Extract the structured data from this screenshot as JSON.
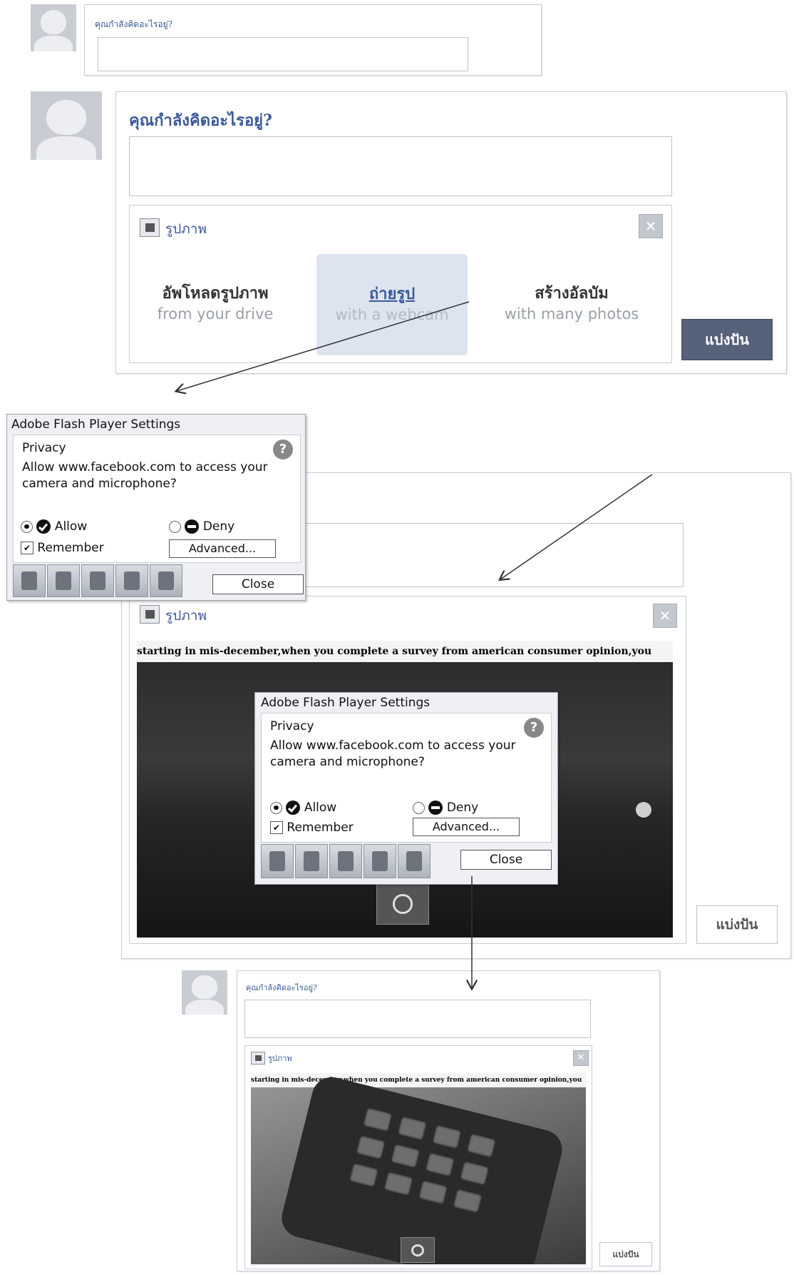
{
  "prompt": "คุณกำลังคิดอะไรอยู่?",
  "photo_panel": {
    "title": "รูปภาพ",
    "close_glyph": "✕",
    "upload": {
      "title": "อัพโหลดรูปภาพ",
      "subtitle": "from your drive"
    },
    "webcam": {
      "title": "ถ่ายรูป",
      "subtitle": "with a webcam"
    },
    "album": {
      "title": "สร้างอัลบัม",
      "subtitle": "with many photos"
    }
  },
  "share_label": "แบ่งปัน",
  "flash": {
    "title": "Adobe Flash Player Settings",
    "heading": "Privacy",
    "help": "?",
    "message": "Allow www.facebook.com to access your camera and microphone?",
    "allow": "Allow",
    "deny": "Deny",
    "remember": "Remember",
    "check": "✔",
    "advanced": "Advanced...",
    "close": "Close"
  },
  "ticker": "starting in mis-december,when you complete a survey from american consumer opinion,you",
  "colors": {
    "accent": "#3b5998",
    "share_dark": "#56627a",
    "panel_border": "#c7ccd6"
  }
}
